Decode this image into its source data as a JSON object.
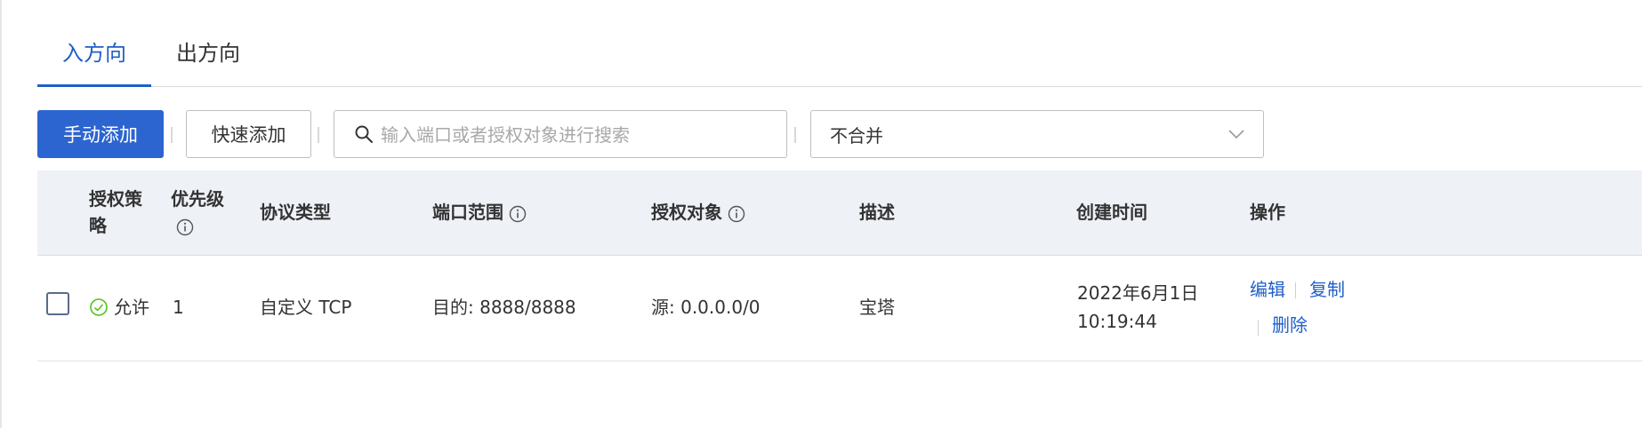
{
  "tabs": [
    {
      "label": "入方向",
      "active": true
    },
    {
      "label": "出方向",
      "active": false
    }
  ],
  "toolbar": {
    "manual_add_label": "手动添加",
    "quick_add_label": "快速添加",
    "search_placeholder": "输入端口或者授权对象进行搜索",
    "search_value": "",
    "merge_select_value": "不合并"
  },
  "table": {
    "headers": {
      "policy": "授权策略",
      "priority": "优先级",
      "protocol": "协议类型",
      "port_range": "端口范围",
      "auth_object": "授权对象",
      "description": "描述",
      "created_time": "创建时间",
      "actions": "操作"
    },
    "rows": [
      {
        "policy": "允许",
        "priority": "1",
        "protocol": "自定义 TCP",
        "port_range": "目的: 8888/8888",
        "auth_object": "源: 0.0.0.0/0",
        "description": "宝塔",
        "created_date": "2022年6月1日",
        "created_time": "10:19:44",
        "actions": {
          "edit": "编辑",
          "copy": "复制",
          "delete": "删除"
        }
      }
    ]
  },
  "colors": {
    "accent": "#1f5fc7",
    "primary_button": "#2c65d0",
    "header_bg": "#eef1f6",
    "allow_green": "#52c41a"
  }
}
